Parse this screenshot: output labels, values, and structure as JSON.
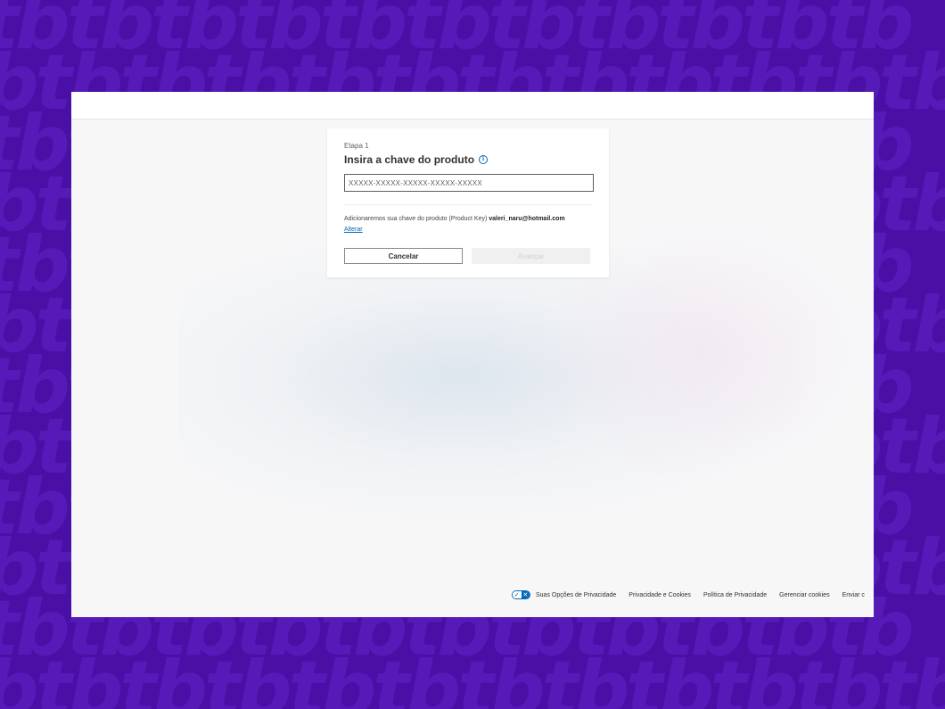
{
  "card": {
    "step": "Etapa 1",
    "title": "Insira a chave do produto",
    "key_placeholder": "XXXXX-XXXXX-XXXXX-XXXXX-XXXXX",
    "account_text": "Adicionaremos sua chave do produto (Product Key)",
    "account_email": "valeri_naru@hotmail.com",
    "change_link": "Alterar",
    "cancel_label": "Cancelar",
    "next_label": "Avançar"
  },
  "footer": {
    "privacy_choices": "Suas Opções de Privacidade",
    "links": [
      "Privacidade e Cookies",
      "Política de Privacidade",
      "Gerenciar cookies",
      "Enviar c"
    ]
  },
  "icons": {
    "info": "info-icon",
    "privacy_toggle": "privacy-toggle-icon"
  },
  "colors": {
    "background": "#4a10a6",
    "accent": "#0067b8"
  }
}
